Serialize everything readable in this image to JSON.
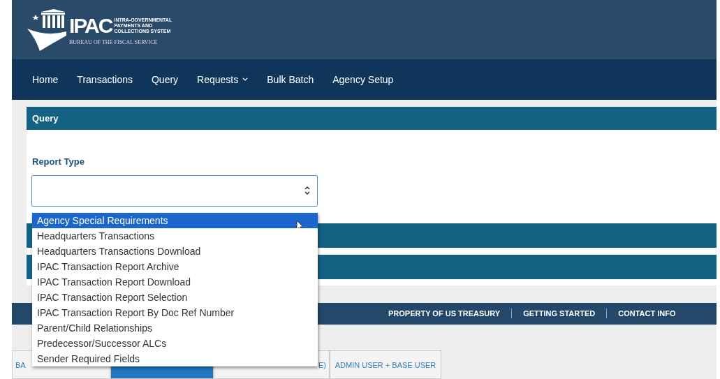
{
  "logo": {
    "acronym": "IPAC",
    "lines": [
      "INTRA-GOVERNMENTAL",
      "PAYMENTS AND",
      "COLLECTIONS SYSTEM"
    ],
    "subtitle": "BUREAU OF THE FISCAL SERVICE"
  },
  "nav": [
    {
      "label": "Home",
      "dropdown": false
    },
    {
      "label": "Transactions",
      "dropdown": false
    },
    {
      "label": "Query",
      "dropdown": false
    },
    {
      "label": "Requests",
      "dropdown": true
    },
    {
      "label": "Bulk Batch",
      "dropdown": false
    },
    {
      "label": "Agency Setup",
      "dropdown": false
    }
  ],
  "section": {
    "title": "Query"
  },
  "report_type": {
    "label": "Report Type",
    "expanded": true,
    "options": [
      {
        "label": "Agency Special Requirements",
        "selected": true
      },
      {
        "label": "Headquarters Transactions",
        "selected": false
      },
      {
        "label": "Headquarters Transactions Download",
        "selected": false
      },
      {
        "label": "IPAC Transaction Report Archive",
        "selected": false
      },
      {
        "label": "IPAC Transaction Report Download",
        "selected": false
      },
      {
        "label": "IPAC Transaction Report Selection",
        "selected": false
      },
      {
        "label": "IPAC Transaction Report By Doc Ref Number",
        "selected": false
      },
      {
        "label": "Parent/Child Relationships",
        "selected": false
      },
      {
        "label": "Predecessor/Successor ALCs",
        "selected": false
      },
      {
        "label": "Sender Required Fields",
        "selected": false
      }
    ]
  },
  "footer_links": [
    "PROPERTY OF US TREASURY",
    "GETTING STARTED",
    "CONTACT INFO"
  ],
  "user_tabs": [
    {
      "label": "BA",
      "selected": false
    },
    {
      "selected": true
    },
    {
      "label": "E)",
      "selected": false
    },
    {
      "label": "ADMIN USER + BASE USER",
      "selected": false
    }
  ]
}
